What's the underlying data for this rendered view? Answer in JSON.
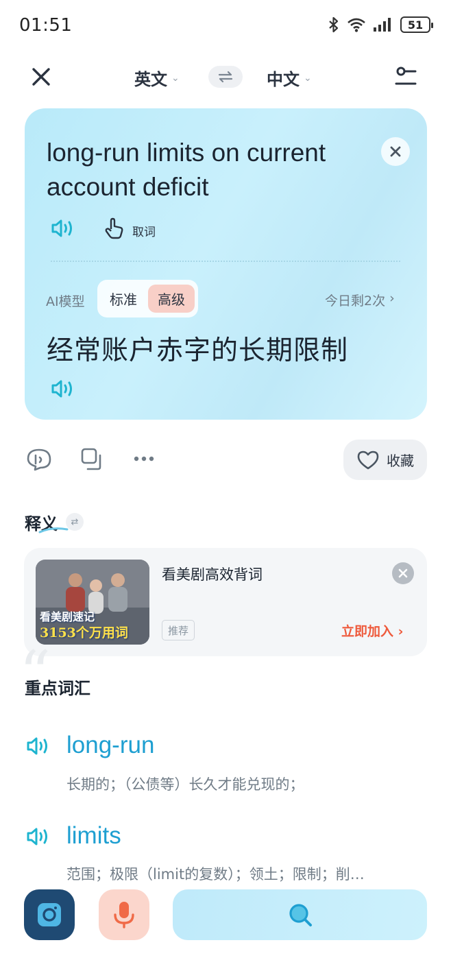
{
  "status": {
    "time": "01:51",
    "battery": "51"
  },
  "header": {
    "source_lang": "英文",
    "target_lang": "中文"
  },
  "card": {
    "source_text": "long-run limits on current account deficit",
    "pick_word_label": "取词",
    "ai_model_label": "AI模型",
    "model_standard": "标准",
    "model_advanced": "高级",
    "quota_text": "今日剩2次",
    "translation": "经常账户赤字的长期限制"
  },
  "actions": {
    "favorite_label": "收藏"
  },
  "definition": {
    "title": "释义"
  },
  "promo": {
    "title": "看美剧高效背词",
    "tag": "推荐",
    "cta": "立即加入 ›",
    "thumb_line1": "看美剧速记",
    "thumb_line2": "3153个万用词"
  },
  "vocab": {
    "title": "重点词汇",
    "items": [
      {
        "word": "long-run",
        "definition": "长期的；（公债等）长久才能兑现的；"
      },
      {
        "word": "limits",
        "definition": "范围；极限（limit的复数）；领土；限制；削…"
      }
    ]
  },
  "colors": {
    "accent": "#1e9fd1",
    "cta": "#ee5a3c",
    "camera": "#1f4a73",
    "mic": "#fbd6cc"
  }
}
